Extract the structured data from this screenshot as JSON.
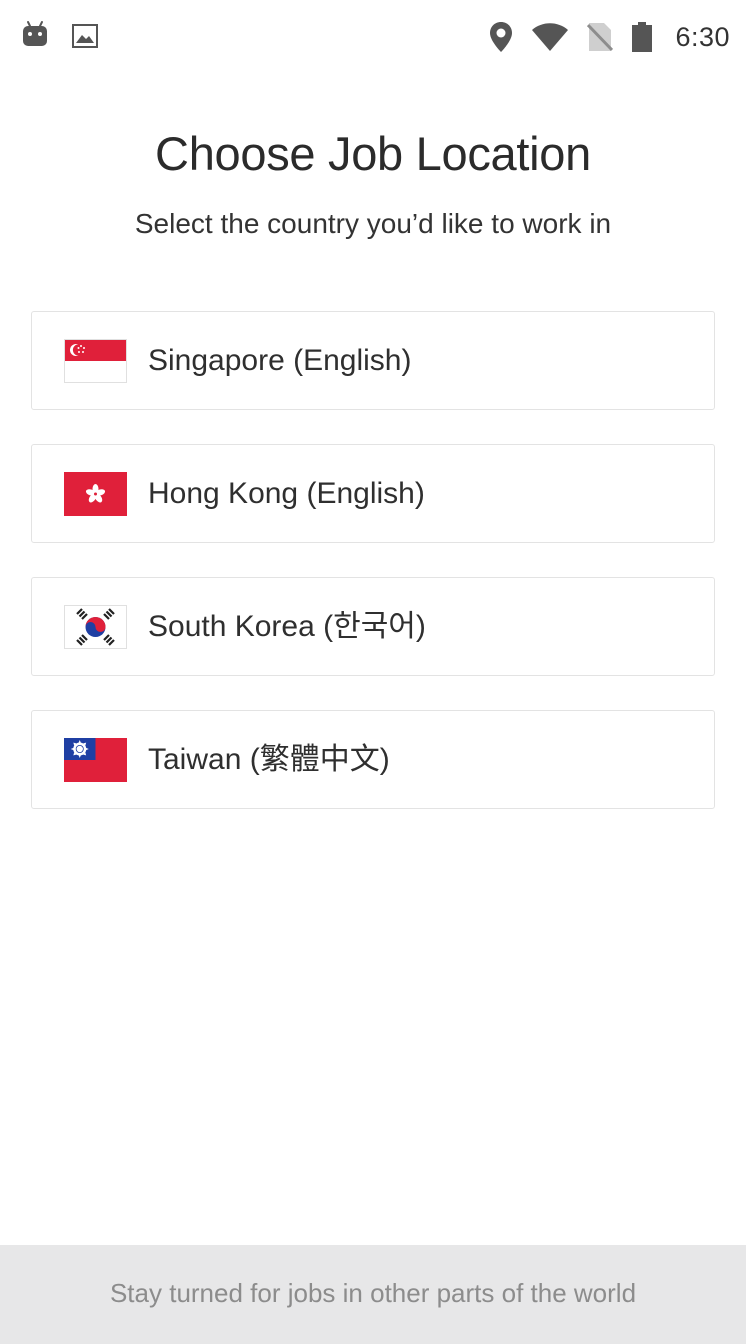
{
  "status_bar": {
    "left_icons": [
      "android-icon",
      "image-icon"
    ],
    "right_icons": [
      "location-icon",
      "wifi-icon",
      "no-sim-icon",
      "battery-icon"
    ],
    "time": "6:30"
  },
  "header": {
    "title": "Choose Job Location",
    "subtitle": "Select the country you’d like to work in"
  },
  "countries": [
    {
      "label": "Singapore (English)",
      "flag_icon": "singapore-flag-icon"
    },
    {
      "label": "Hong Kong (English)",
      "flag_icon": "hong-kong-flag-icon"
    },
    {
      "label": "South Korea (한국어)",
      "flag_icon": "south-korea-flag-icon"
    },
    {
      "label": "Taiwan (繁體中文)",
      "flag_icon": "taiwan-flag-icon"
    }
  ],
  "footer": {
    "text": "Stay turned for jobs in other parts of the world"
  },
  "colors": {
    "text_primary": "#2f2f2f",
    "footer_bg": "#e7e7e8",
    "footer_text": "#8c8c8c",
    "card_border": "#e3e3e3",
    "flag_red": "#e0203a",
    "flag_blue": "#1f3fa3"
  }
}
